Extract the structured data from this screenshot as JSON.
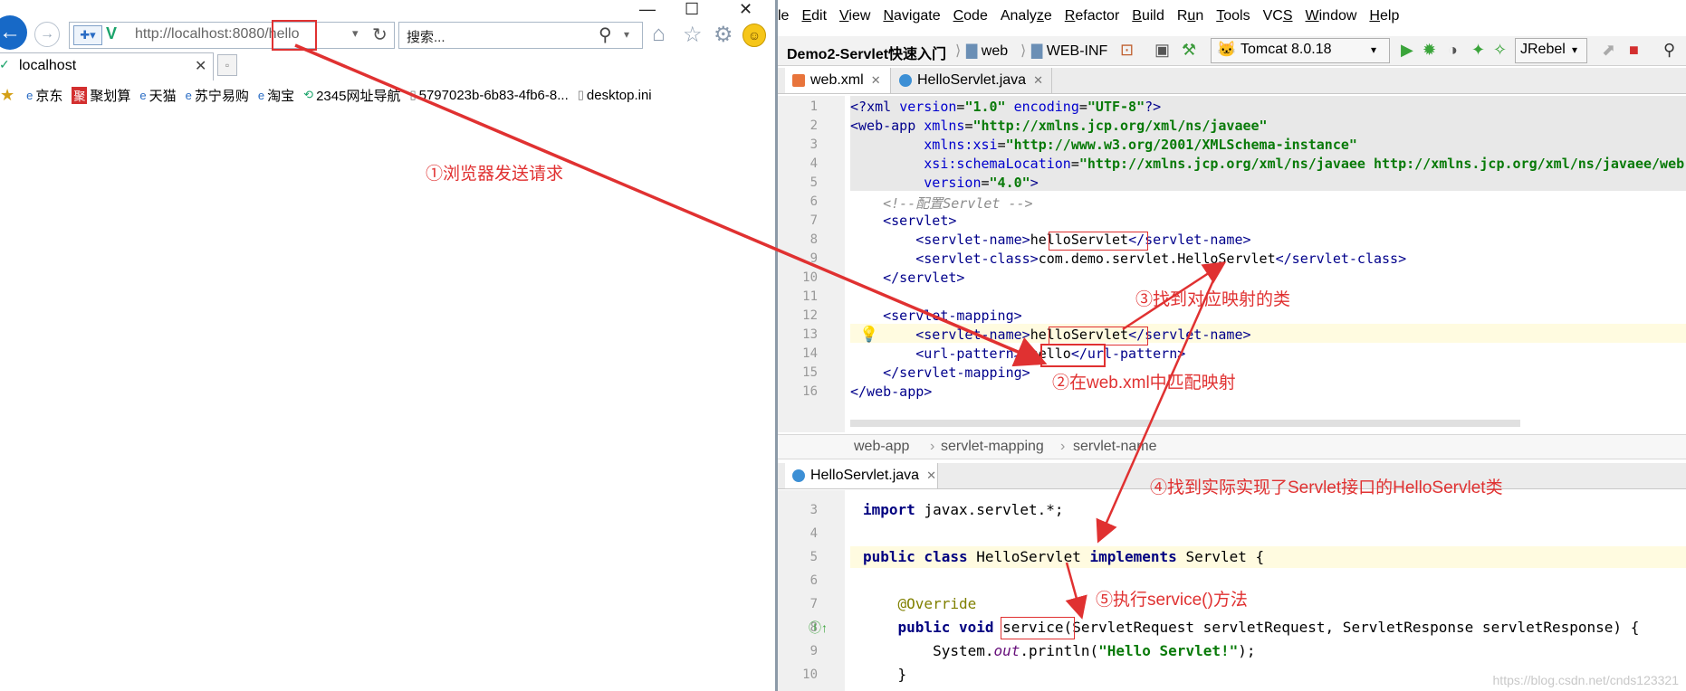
{
  "browser": {
    "window_controls": {
      "minimize": "—",
      "maximize": "☐",
      "close": "✕"
    },
    "address": {
      "url_base": "http://localhost:8080",
      "url_path": "/hello"
    },
    "search": {
      "value": "搜索..."
    },
    "tab": {
      "title": "localhost"
    },
    "favorites": [
      "京东",
      "聚划算",
      "天猫",
      "苏宁易购",
      "淘宝",
      "2345网址导航",
      "5797023b-6b83-4fb6-8...",
      "desktop.ini"
    ]
  },
  "ide": {
    "menu": [
      {
        "pre": "",
        "u": "",
        "post": "le"
      },
      {
        "pre": "",
        "u": "E",
        "post": "dit"
      },
      {
        "pre": "",
        "u": "V",
        "post": "iew"
      },
      {
        "pre": "",
        "u": "N",
        "post": "avigate"
      },
      {
        "pre": "",
        "u": "C",
        "post": "ode"
      },
      {
        "pre": "Analy",
        "u": "z",
        "post": "e"
      },
      {
        "pre": "",
        "u": "R",
        "post": "efactor"
      },
      {
        "pre": "",
        "u": "B",
        "post": "uild"
      },
      {
        "pre": "R",
        "u": "u",
        "post": "n"
      },
      {
        "pre": "",
        "u": "T",
        "post": "ools"
      },
      {
        "pre": "VC",
        "u": "S",
        "post": ""
      },
      {
        "pre": "",
        "u": "W",
        "post": "indow"
      },
      {
        "pre": "",
        "u": "H",
        "post": "elp"
      }
    ],
    "toolbar": {
      "project": "Demo2-Servlet快速入门",
      "folder1": "web",
      "folder2": "WEB-INF",
      "run_config": "Tomcat 8.0.18",
      "jrebel": "JRebel"
    },
    "tabs": [
      "web.xml",
      "HelloServlet.java"
    ],
    "bottom_tab": "HelloServlet.java",
    "breadcrumb": [
      "web-app",
      "servlet-mapping",
      "servlet-name"
    ],
    "xml_line_numbers": [
      "1",
      "2",
      "3",
      "4",
      "5",
      "6",
      "7",
      "8",
      "9",
      "10",
      "11",
      "12",
      "13",
      "14",
      "15",
      "16"
    ],
    "java_line_numbers": [
      "3",
      "4",
      "5",
      "6",
      "7",
      "8",
      "9",
      "10"
    ]
  },
  "annotations": {
    "a1": "①浏览器发送请求",
    "a2": "②在web.xml中匹配映射",
    "a3": "③找到对应映射的类",
    "a4": "④找到实际实现了Servlet接口的HelloServlet类",
    "a5": "⑤执行service()方法"
  },
  "watermark": "https://blog.csdn.net/cnds123321",
  "colors": {
    "annotation": "#e03131",
    "back_button": "#1769c7",
    "keyword": "#000080",
    "string": "#087a08"
  }
}
